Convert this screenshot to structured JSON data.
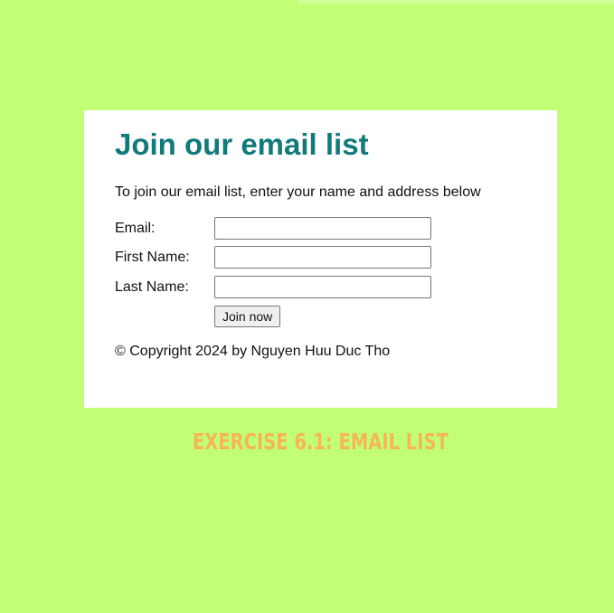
{
  "colors": {
    "background": "#c1ff75",
    "card": "#ffffff",
    "title": "#117a7a",
    "caption": "#f7b55a"
  },
  "form": {
    "title": "Join our email list",
    "intro": "To join our email list, enter your name and address below",
    "fields": [
      {
        "label": "Email:",
        "value": "",
        "placeholder": ""
      },
      {
        "label": "First Name:",
        "value": "",
        "placeholder": ""
      },
      {
        "label": "Last Name:",
        "value": "",
        "placeholder": ""
      }
    ],
    "submit_label": "Join now",
    "copyright": "© Copyright 2024 by Nguyen Huu Duc Tho"
  },
  "caption": "EXERCISE 6.1: EMAIL LIST"
}
